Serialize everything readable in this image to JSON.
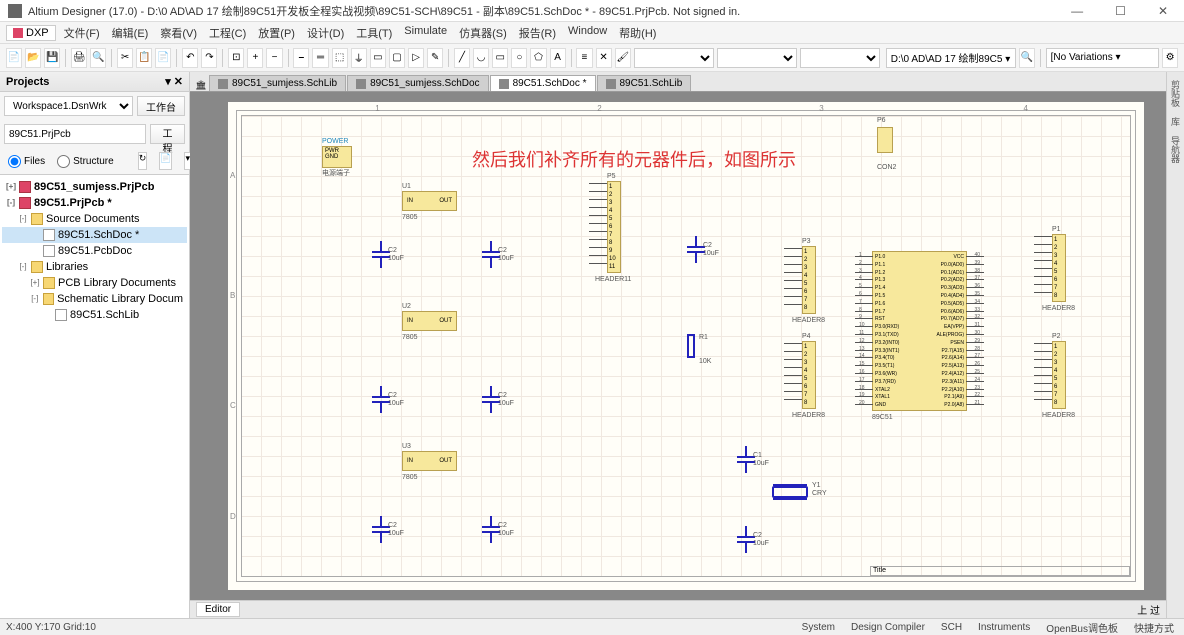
{
  "titlebar": {
    "text": "Altium Designer (17.0) - D:\\0 AD\\AD 17 绘制89C51开发板全程实战视频\\89C51-SCH\\89C51 - 副本\\89C51.SchDoc * - 89C51.PrjPcb. Not signed in."
  },
  "menu": {
    "dxp": "DXP",
    "items": [
      "文件(F)",
      "编辑(E)",
      "察看(V)",
      "工程(C)",
      "放置(P)",
      "设计(D)",
      "工具(T)",
      "Simulate",
      "仿真器(S)",
      "报告(R)",
      "Window",
      "帮助(H)"
    ]
  },
  "toolbar": {
    "path_combo": "D:\\0 AD\\AD 17 绘制89C5 ▾",
    "variations": "[No Variations ▾"
  },
  "projects_panel": {
    "title": "Projects",
    "workspace_combo": "Workspace1.DsnWrk",
    "workspace_btn": "工作台",
    "project_input": "89C51.PrjPcb",
    "project_btn": "工程",
    "radio_files": "Files",
    "radio_structure": "Structure",
    "tree": [
      {
        "level": 0,
        "toggle": "+",
        "icon": "proj",
        "label": "89C51_sumjess.PrjPcb",
        "bold": true
      },
      {
        "level": 0,
        "toggle": "-",
        "icon": "proj",
        "label": "89C51.PrjPcb *",
        "bold": true
      },
      {
        "level": 1,
        "toggle": "-",
        "icon": "folder",
        "label": "Source Documents"
      },
      {
        "level": 2,
        "toggle": "",
        "icon": "doc",
        "label": "89C51.SchDoc *",
        "selected": true
      },
      {
        "level": 2,
        "toggle": "",
        "icon": "doc",
        "label": "89C51.PcbDoc"
      },
      {
        "level": 1,
        "toggle": "-",
        "icon": "folder",
        "label": "Libraries"
      },
      {
        "level": 2,
        "toggle": "+",
        "icon": "folder",
        "label": "PCB Library Documents"
      },
      {
        "level": 2,
        "toggle": "-",
        "icon": "folder",
        "label": "Schematic Library Docum"
      },
      {
        "level": 3,
        "toggle": "",
        "icon": "doc",
        "label": "89C51.SchLib"
      }
    ]
  },
  "tabs": [
    {
      "label": "89C51_sumjess.SchLib",
      "active": false
    },
    {
      "label": "89C51_sumjess.SchDoc",
      "active": false
    },
    {
      "label": "89C51.SchDoc *",
      "active": true
    },
    {
      "label": "89C51.SchLib",
      "active": false
    }
  ],
  "sheet": {
    "ruler_top": [
      "1",
      "2",
      "3",
      "4"
    ],
    "ruler_left": [
      "A",
      "B",
      "C",
      "D"
    ],
    "annotation": "然后我们补齐所有的元器件后，如图所示",
    "title_block": "Title",
    "components": {
      "power": {
        "ref": "POWER",
        "pins": [
          "PWR",
          "GND"
        ],
        "footer": "电源端子"
      },
      "u1": {
        "ref": "U1",
        "in": "IN",
        "out": "OUT",
        "foot": "7805"
      },
      "u2": {
        "ref": "U2",
        "in": "IN",
        "out": "OUT",
        "foot": "7805"
      },
      "u3": {
        "ref": "U3",
        "in": "IN",
        "out": "OUT",
        "foot": "7805"
      },
      "caps_10uf": [
        "C2 10uF",
        "C2 10uF",
        "C2 10uF",
        "C2 10uF",
        "C2 10uF",
        "C2 10uF",
        "C2 10uF",
        "C1 10uF",
        "C2 10uF"
      ],
      "r1": {
        "ref": "R1",
        "val": "10K"
      },
      "y1": {
        "ref": "Y1",
        "val": "CRY"
      },
      "p5": {
        "ref": "P5",
        "pins": [
          "1",
          "2",
          "3",
          "4",
          "5",
          "6",
          "7",
          "8",
          "9",
          "10",
          "11"
        ],
        "foot": "HEADER11"
      },
      "p3": {
        "ref": "P3",
        "pins": [
          "1",
          "2",
          "3",
          "4",
          "5",
          "6",
          "7",
          "8"
        ],
        "foot": "HEADER8"
      },
      "p4": {
        "ref": "P4",
        "pins": [
          "1",
          "2",
          "3",
          "4",
          "5",
          "6",
          "7",
          "8"
        ],
        "foot": "HEADER8"
      },
      "p1": {
        "ref": "P1",
        "pins": [
          "1",
          "2",
          "3",
          "4",
          "5",
          "6",
          "7",
          "8"
        ],
        "foot": "HEADER8"
      },
      "p2": {
        "ref": "P2",
        "pins": [
          "1",
          "2",
          "3",
          "4",
          "5",
          "6",
          "7",
          "8"
        ],
        "foot": "HEADER8"
      },
      "p6": {
        "ref": "P6",
        "foot": "CON2"
      },
      "mcu": {
        "ref": "89C51",
        "left_nums": [
          "1",
          "2",
          "3",
          "4",
          "5",
          "6",
          "7",
          "8",
          "9",
          "10",
          "11",
          "12",
          "13",
          "14",
          "15",
          "16",
          "17",
          "18",
          "19",
          "20"
        ],
        "left_labels": [
          "P1.0",
          "P1.1",
          "P1.2",
          "P1.3",
          "P1.4",
          "P1.5",
          "P1.6",
          "P1.7",
          "RST",
          "P3.0(RXD)",
          "P3.1(TXD)",
          "P3.2(INT0)",
          "P3.3(INT1)",
          "P3.4(T0)",
          "P3.5(T1)",
          "P3.6(WR)",
          "P3.7(RD)",
          "XTAL2",
          "XTAL1",
          "GND"
        ],
        "right_nums": [
          "40",
          "39",
          "38",
          "37",
          "36",
          "35",
          "34",
          "33",
          "32",
          "31",
          "30",
          "29",
          "28",
          "27",
          "26",
          "25",
          "24",
          "23",
          "22",
          "21"
        ],
        "right_labels": [
          "VCC",
          "P0.0(AD0)",
          "P0.1(AD1)",
          "P0.2(AD2)",
          "P0.3(AD3)",
          "P0.4(AD4)",
          "P0.5(AD5)",
          "P0.6(AD6)",
          "P0.7(AD7)",
          "EA(VPP)",
          "ALE(PROG)",
          "PSEN",
          "P2.7(A15)",
          "P2.6(A14)",
          "P2.5(A13)",
          "P2.4(A12)",
          "P2.3(A11)",
          "P2.2(A10)",
          "P2.1(A9)",
          "P2.0(A8)"
        ]
      }
    }
  },
  "editor_bar": {
    "label": "Editor",
    "right": "上 过"
  },
  "statusbar": {
    "coords": "X:400 Y:170  Grid:10",
    "items": [
      "System",
      "Design Compiler",
      "SCH",
      "Instruments",
      "OpenBus调色板",
      "快捷方式"
    ]
  },
  "right_strip": [
    "剪贴板",
    "库",
    "导航器"
  ]
}
